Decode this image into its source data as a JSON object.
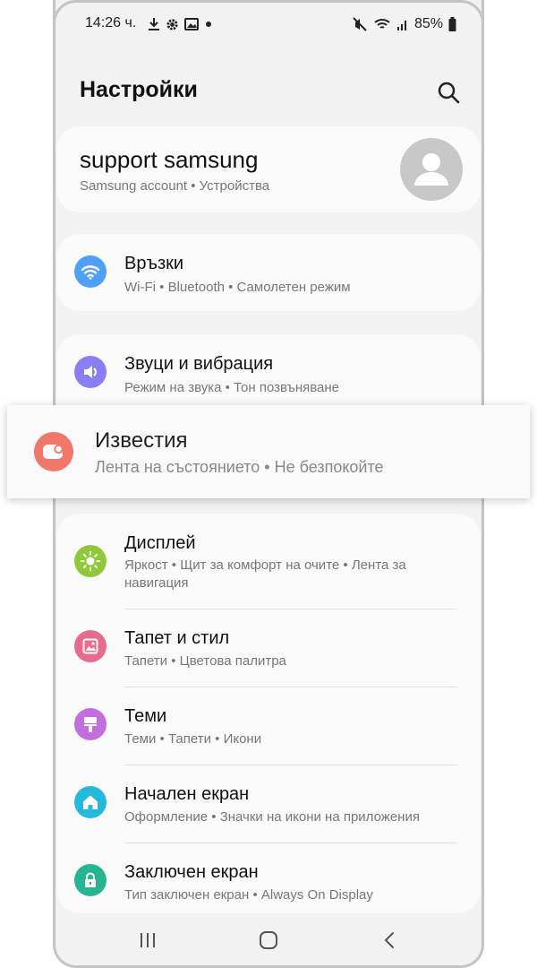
{
  "status_bar": {
    "time": "14:26 ч.",
    "battery": "85%"
  },
  "header": {
    "title": "Настройки"
  },
  "account": {
    "name": "support samsung",
    "subtitle": "Samsung account  •  Устройства"
  },
  "items": [
    {
      "title": "Връзки",
      "subtitle": "Wi-Fi  •  Bluetooth  •  Самолетен режим",
      "icon": "wifi-icon",
      "color": "#4f9ff5"
    },
    {
      "title": "Звуци и вибрация",
      "subtitle": "Режим на звука  •  Тон позвъняване",
      "icon": "speaker-icon",
      "color": "#8a7ef2"
    },
    {
      "title": "Известия",
      "subtitle": "Лента на състоянието  •  Не безпокойте",
      "icon": "notification-icon",
      "color": "#f0776a"
    },
    {
      "title": "Дисплей",
      "subtitle": "Яркост  •  Щит за комфорт на очите  •  Лента за навигация",
      "icon": "sun-icon",
      "color": "#8fc93a"
    },
    {
      "title": "Тапет и стил",
      "subtitle": "Тапети  •  Цветова палитра",
      "icon": "image-icon",
      "color": "#ea6a8e"
    },
    {
      "title": "Теми",
      "subtitle": "Теми  •  Тапети  •  Икони",
      "icon": "brush-icon",
      "color": "#c16fdc"
    },
    {
      "title": "Начален екран",
      "subtitle": "Оформление  •  Значки на икони на приложения",
      "icon": "home-icon",
      "color": "#27b9dc"
    },
    {
      "title": "Заключен екран",
      "subtitle": "Тип заключен екран  •  Always On Display",
      "icon": "lock-icon",
      "color": "#26b590"
    }
  ]
}
